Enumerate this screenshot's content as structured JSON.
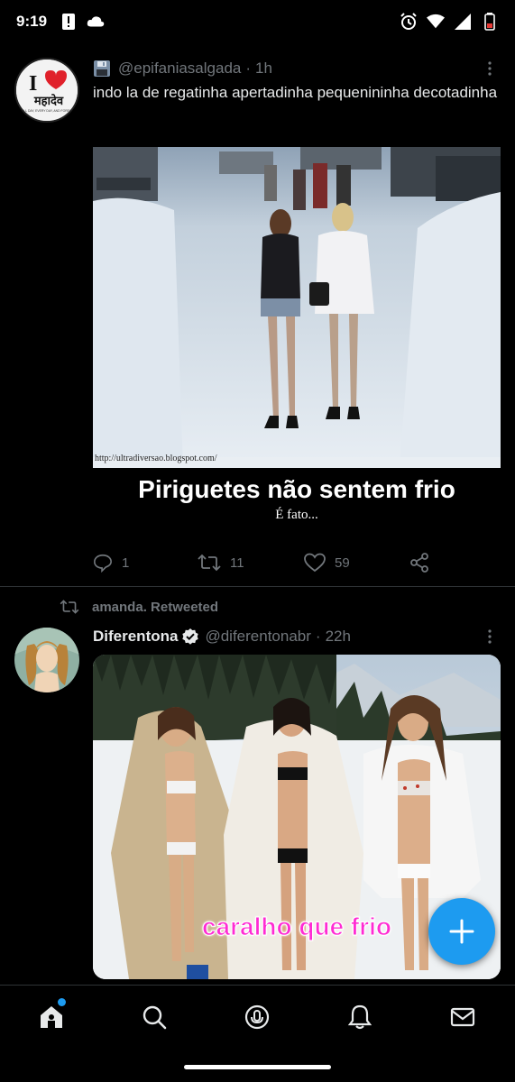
{
  "status_bar": {
    "time": "9:19",
    "icons_left": [
      "alert-icon",
      "cloud-icon"
    ],
    "icons_right": [
      "alarm-icon",
      "wifi-icon",
      "signal-icon",
      "battery-low-icon"
    ]
  },
  "tweet1": {
    "handle": "@epifaniasalgada",
    "separator": "·",
    "time": "1h",
    "text": "indo la de regatinha apertadinha pequenininha decotadinha",
    "avatar_logo": {
      "top": "I",
      "script": "महादेव",
      "tagline": "ALL DAY, EVERY DAY, AND FOREVER"
    },
    "media": {
      "url_text": "http://ultradiversao.blogspot.com/",
      "caption_main": "Piriguetes não sentem frio",
      "caption_sub": "É fato..."
    },
    "actions": {
      "replies": "1",
      "retweets": "11",
      "likes": "59"
    }
  },
  "tweet2": {
    "retweeted_by": "amanda. Retweeted",
    "name": "Diferentona",
    "handle": "@diferentonabr",
    "separator": "·",
    "time": "22h",
    "media": {
      "caption": "caralho que frio"
    }
  },
  "colors": {
    "accent": "#1d9bf0",
    "background": "#000000",
    "secondary_text": "#71767b",
    "caption_pink": "#ff2bd3"
  },
  "nav": [
    "home-icon",
    "search-icon",
    "spaces-icon",
    "notifications-icon",
    "messages-icon"
  ]
}
